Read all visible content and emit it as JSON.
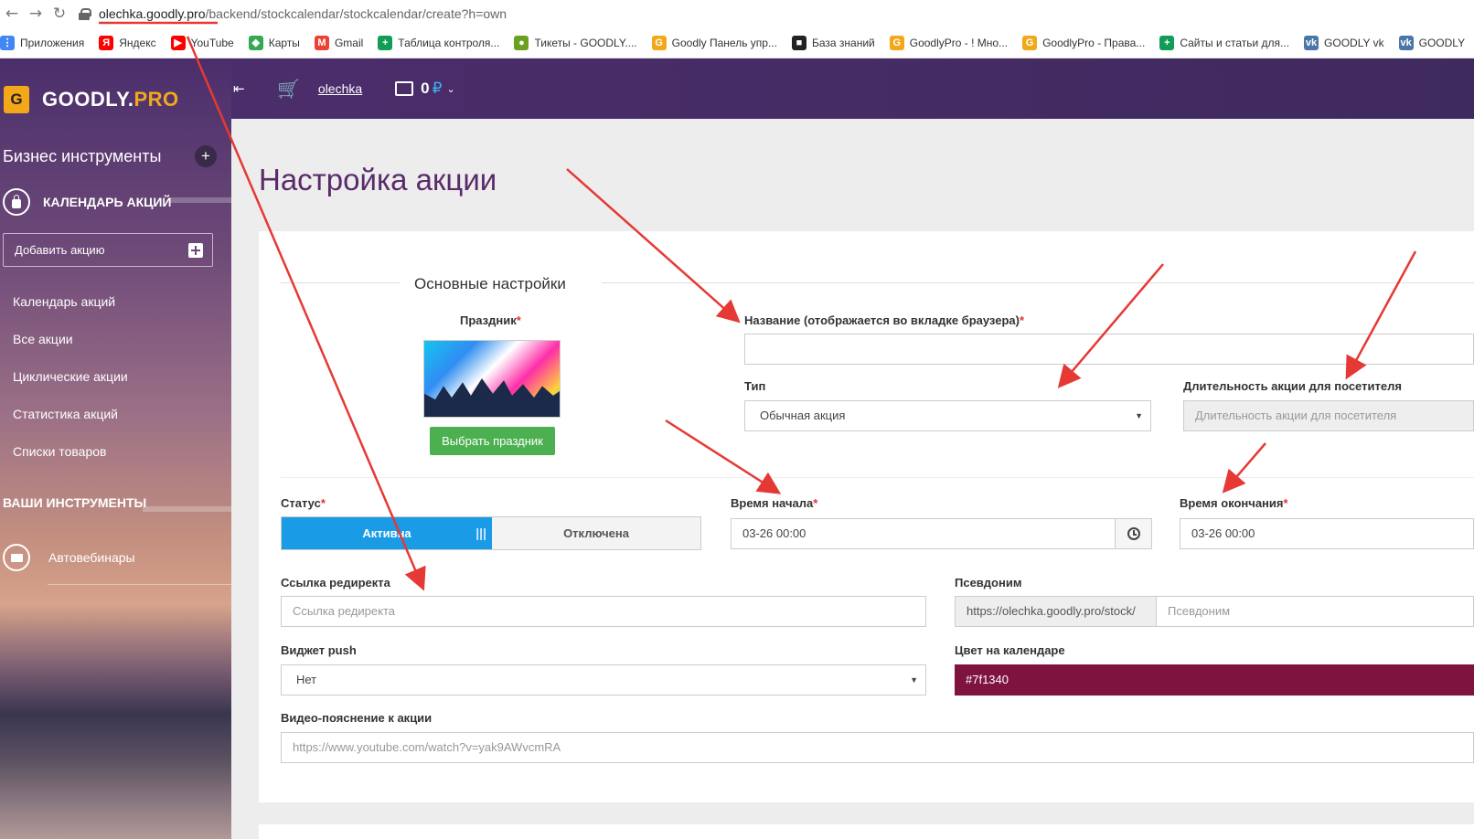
{
  "browser": {
    "url_host": "olechka.goodly.pro",
    "url_path": "/backend/stockcalendar/stockcalendar/create?h=own",
    "bookmarks": [
      {
        "label": "Приложения",
        "icon": "apps-grid-icon",
        "color": "#4285f4",
        "glyph": "⋮"
      },
      {
        "label": "Яндекс",
        "icon": "yandex-icon",
        "color": "#ff0000",
        "glyph": "Я"
      },
      {
        "label": "YouTube",
        "icon": "youtube-icon",
        "color": "#ff0000",
        "glyph": "▶"
      },
      {
        "label": "Карты",
        "icon": "maps-icon",
        "color": "#34a853",
        "glyph": "◆"
      },
      {
        "label": "Gmail",
        "icon": "gmail-icon",
        "color": "#ea4335",
        "glyph": "M"
      },
      {
        "label": "Таблица контроля...",
        "icon": "sheets-icon",
        "color": "#0f9d58",
        "glyph": "+"
      },
      {
        "label": "Тикеты - GOODLY....",
        "icon": "ticket-icon",
        "color": "#6aa121",
        "glyph": "●"
      },
      {
        "label": "Goodly Панель упр...",
        "icon": "goodly-icon",
        "color": "#f3a81a",
        "glyph": "G"
      },
      {
        "label": "База знаний",
        "icon": "book-icon",
        "color": "#222222",
        "glyph": "■"
      },
      {
        "label": "GoodlyPro - ! Мно...",
        "icon": "goodly-icon",
        "color": "#f3a81a",
        "glyph": "G"
      },
      {
        "label": "GoodlyPro - Права...",
        "icon": "goodly-icon",
        "color": "#f3a81a",
        "glyph": "G"
      },
      {
        "label": "Сайты и статьи для...",
        "icon": "sheets-icon",
        "color": "#0f9d58",
        "glyph": "+"
      },
      {
        "label": "GOODLY vk",
        "icon": "vk-icon",
        "color": "#4a76a8",
        "glyph": "vk"
      },
      {
        "label": "GOODLY",
        "icon": "vk-icon",
        "color": "#4a76a8",
        "glyph": "vk"
      }
    ]
  },
  "sidebar": {
    "logo_main": "GOODLY.",
    "logo_pro": "PRO",
    "logo_glyph": "G",
    "heading": "Бизнес инструменты",
    "section": "КАЛЕНДАРЬ АКЦИЙ",
    "add_button": "Добавить акцию",
    "items": [
      "Календарь акций",
      "Все акции",
      "Циклические акции",
      "Статистика акций",
      "Списки товаров"
    ],
    "section2": "ВАШИ ИНСТРУМЕНТЫ",
    "webinars": "Автовебинары"
  },
  "appbar": {
    "user": "olechka",
    "balance": "0",
    "currency": "₽"
  },
  "page": {
    "title": "Настройка акции"
  },
  "form": {
    "legend": "Основные настройки",
    "holiday_label": "Праздник",
    "holiday_button": "Выбрать праздник",
    "name_label": "Название (отображается во вкладке браузера)",
    "name_value": "",
    "type_label": "Тип",
    "type_value": "Обычная акция",
    "duration_label": "Длительность акции для посетителя",
    "duration_placeholder": "Длительность акции для посетителя",
    "status_label": "Статус",
    "status_on": "Активна",
    "status_off": "Отключена",
    "start_label": "Время начала",
    "start_value": "03-26 00:00",
    "end_label": "Время окончания",
    "end_value": "03-26 00:00",
    "redirect_label": "Ссылка редиректа",
    "redirect_placeholder": "Ссылка редиректа",
    "alias_label": "Псевдоним",
    "alias_prefix": "https://olechka.goodly.pro/stock/",
    "alias_placeholder": "Псевдоним",
    "push_label": "Виджет push",
    "push_value": "Нет",
    "color_label": "Цвет на календаре",
    "color_value": "#7f1340",
    "video_label": "Видео-пояснение к акции",
    "video_placeholder": "https://www.youtube.com/watch?v=yak9AWvcmRA",
    "required_mark": "*"
  },
  "colors": {
    "accent_purple": "#5a2b6b",
    "toggle_blue": "#1a9be6",
    "button_green": "#4cb050",
    "annotation_red": "#e53935",
    "calendar_color": "#7f1340"
  }
}
